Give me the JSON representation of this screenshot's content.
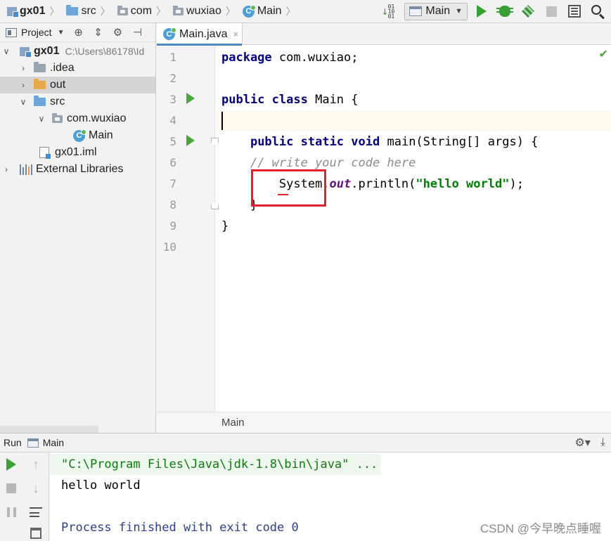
{
  "navbar": {
    "crumbs": [
      {
        "label": "gx01",
        "icon": "module-icon"
      },
      {
        "label": "src",
        "icon": "folder-icon"
      },
      {
        "label": "com",
        "icon": "package-icon"
      },
      {
        "label": "wuxiao",
        "icon": "package-icon"
      },
      {
        "label": "Main",
        "icon": "class-icon"
      }
    ],
    "run_config": "Main",
    "class_icon_letter": "C"
  },
  "project": {
    "title": "Project",
    "tree": [
      {
        "label": "gx01",
        "path": "C:\\Users\\86178\\Id"
      },
      {
        "label": ".idea"
      },
      {
        "label": "out"
      },
      {
        "label": "src"
      },
      {
        "label": "com.wuxiao"
      },
      {
        "label": "Main"
      },
      {
        "label": "gx01.iml"
      },
      {
        "label": "External Libraries"
      }
    ]
  },
  "editor": {
    "tab": {
      "label": "Main.java",
      "close": "×"
    },
    "line_numbers": [
      "1",
      "2",
      "3",
      "4",
      "5",
      "6",
      "7",
      "8",
      "9",
      "10"
    ],
    "code": {
      "l1_kw": "package",
      "l1_rest": " com.wuxiao;",
      "l3_kw1": "public",
      "l3_kw2": "class",
      "l3_rest": " Main {",
      "l5_kw1": "public",
      "l5_kw2": "static",
      "l5_kw3": "void",
      "l5_rest": " main(String[] args) {",
      "l6_comment": "// write your code here",
      "l7_sys": "System.",
      "l7_field": "out",
      "l7_call": ".println(",
      "l7_str": "\"hello world\"",
      "l7_end": ");",
      "l8_brace": "}",
      "l9_brace": "}"
    },
    "breadcrumb": "Main"
  },
  "run_panel": {
    "label": "Run",
    "config": "Main",
    "console": {
      "command": "\"C:\\Program Files\\Java\\jdk-1.8\\bin\\java\" ...",
      "output": "hello world",
      "exit": "Process finished with exit code 0"
    }
  },
  "watermark": "CSDN @今早晚点睡喔",
  "colors": {
    "keyword": "#000080",
    "string": "#008000",
    "field": "#660e7a",
    "comment": "#8c8c8c",
    "annotation_box": "#e8202a",
    "run_green": "#3ba034"
  }
}
